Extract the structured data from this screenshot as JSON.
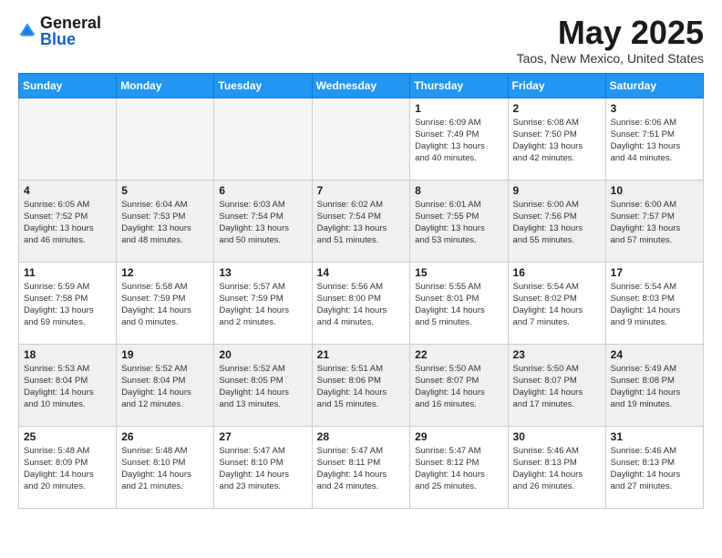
{
  "header": {
    "logo_general": "General",
    "logo_blue": "Blue",
    "month_title": "May 2025",
    "location": "Taos, New Mexico, United States"
  },
  "weekdays": [
    "Sunday",
    "Monday",
    "Tuesday",
    "Wednesday",
    "Thursday",
    "Friday",
    "Saturday"
  ],
  "weeks": [
    [
      {
        "day": "",
        "info": ""
      },
      {
        "day": "",
        "info": ""
      },
      {
        "day": "",
        "info": ""
      },
      {
        "day": "",
        "info": ""
      },
      {
        "day": "1",
        "info": "Sunrise: 6:09 AM\nSunset: 7:49 PM\nDaylight: 13 hours\nand 40 minutes."
      },
      {
        "day": "2",
        "info": "Sunrise: 6:08 AM\nSunset: 7:50 PM\nDaylight: 13 hours\nand 42 minutes."
      },
      {
        "day": "3",
        "info": "Sunrise: 6:06 AM\nSunset: 7:51 PM\nDaylight: 13 hours\nand 44 minutes."
      }
    ],
    [
      {
        "day": "4",
        "info": "Sunrise: 6:05 AM\nSunset: 7:52 PM\nDaylight: 13 hours\nand 46 minutes."
      },
      {
        "day": "5",
        "info": "Sunrise: 6:04 AM\nSunset: 7:53 PM\nDaylight: 13 hours\nand 48 minutes."
      },
      {
        "day": "6",
        "info": "Sunrise: 6:03 AM\nSunset: 7:54 PM\nDaylight: 13 hours\nand 50 minutes."
      },
      {
        "day": "7",
        "info": "Sunrise: 6:02 AM\nSunset: 7:54 PM\nDaylight: 13 hours\nand 51 minutes."
      },
      {
        "day": "8",
        "info": "Sunrise: 6:01 AM\nSunset: 7:55 PM\nDaylight: 13 hours\nand 53 minutes."
      },
      {
        "day": "9",
        "info": "Sunrise: 6:00 AM\nSunset: 7:56 PM\nDaylight: 13 hours\nand 55 minutes."
      },
      {
        "day": "10",
        "info": "Sunrise: 6:00 AM\nSunset: 7:57 PM\nDaylight: 13 hours\nand 57 minutes."
      }
    ],
    [
      {
        "day": "11",
        "info": "Sunrise: 5:59 AM\nSunset: 7:58 PM\nDaylight: 13 hours\nand 59 minutes."
      },
      {
        "day": "12",
        "info": "Sunrise: 5:58 AM\nSunset: 7:59 PM\nDaylight: 14 hours\nand 0 minutes."
      },
      {
        "day": "13",
        "info": "Sunrise: 5:57 AM\nSunset: 7:59 PM\nDaylight: 14 hours\nand 2 minutes."
      },
      {
        "day": "14",
        "info": "Sunrise: 5:56 AM\nSunset: 8:00 PM\nDaylight: 14 hours\nand 4 minutes."
      },
      {
        "day": "15",
        "info": "Sunrise: 5:55 AM\nSunset: 8:01 PM\nDaylight: 14 hours\nand 5 minutes."
      },
      {
        "day": "16",
        "info": "Sunrise: 5:54 AM\nSunset: 8:02 PM\nDaylight: 14 hours\nand 7 minutes."
      },
      {
        "day": "17",
        "info": "Sunrise: 5:54 AM\nSunset: 8:03 PM\nDaylight: 14 hours\nand 9 minutes."
      }
    ],
    [
      {
        "day": "18",
        "info": "Sunrise: 5:53 AM\nSunset: 8:04 PM\nDaylight: 14 hours\nand 10 minutes."
      },
      {
        "day": "19",
        "info": "Sunrise: 5:52 AM\nSunset: 8:04 PM\nDaylight: 14 hours\nand 12 minutes."
      },
      {
        "day": "20",
        "info": "Sunrise: 5:52 AM\nSunset: 8:05 PM\nDaylight: 14 hours\nand 13 minutes."
      },
      {
        "day": "21",
        "info": "Sunrise: 5:51 AM\nSunset: 8:06 PM\nDaylight: 14 hours\nand 15 minutes."
      },
      {
        "day": "22",
        "info": "Sunrise: 5:50 AM\nSunset: 8:07 PM\nDaylight: 14 hours\nand 16 minutes."
      },
      {
        "day": "23",
        "info": "Sunrise: 5:50 AM\nSunset: 8:07 PM\nDaylight: 14 hours\nand 17 minutes."
      },
      {
        "day": "24",
        "info": "Sunrise: 5:49 AM\nSunset: 8:08 PM\nDaylight: 14 hours\nand 19 minutes."
      }
    ],
    [
      {
        "day": "25",
        "info": "Sunrise: 5:48 AM\nSunset: 8:09 PM\nDaylight: 14 hours\nand 20 minutes."
      },
      {
        "day": "26",
        "info": "Sunrise: 5:48 AM\nSunset: 8:10 PM\nDaylight: 14 hours\nand 21 minutes."
      },
      {
        "day": "27",
        "info": "Sunrise: 5:47 AM\nSunset: 8:10 PM\nDaylight: 14 hours\nand 23 minutes."
      },
      {
        "day": "28",
        "info": "Sunrise: 5:47 AM\nSunset: 8:11 PM\nDaylight: 14 hours\nand 24 minutes."
      },
      {
        "day": "29",
        "info": "Sunrise: 5:47 AM\nSunset: 8:12 PM\nDaylight: 14 hours\nand 25 minutes."
      },
      {
        "day": "30",
        "info": "Sunrise: 5:46 AM\nSunset: 8:13 PM\nDaylight: 14 hours\nand 26 minutes."
      },
      {
        "day": "31",
        "info": "Sunrise: 5:46 AM\nSunset: 8:13 PM\nDaylight: 14 hours\nand 27 minutes."
      }
    ]
  ]
}
